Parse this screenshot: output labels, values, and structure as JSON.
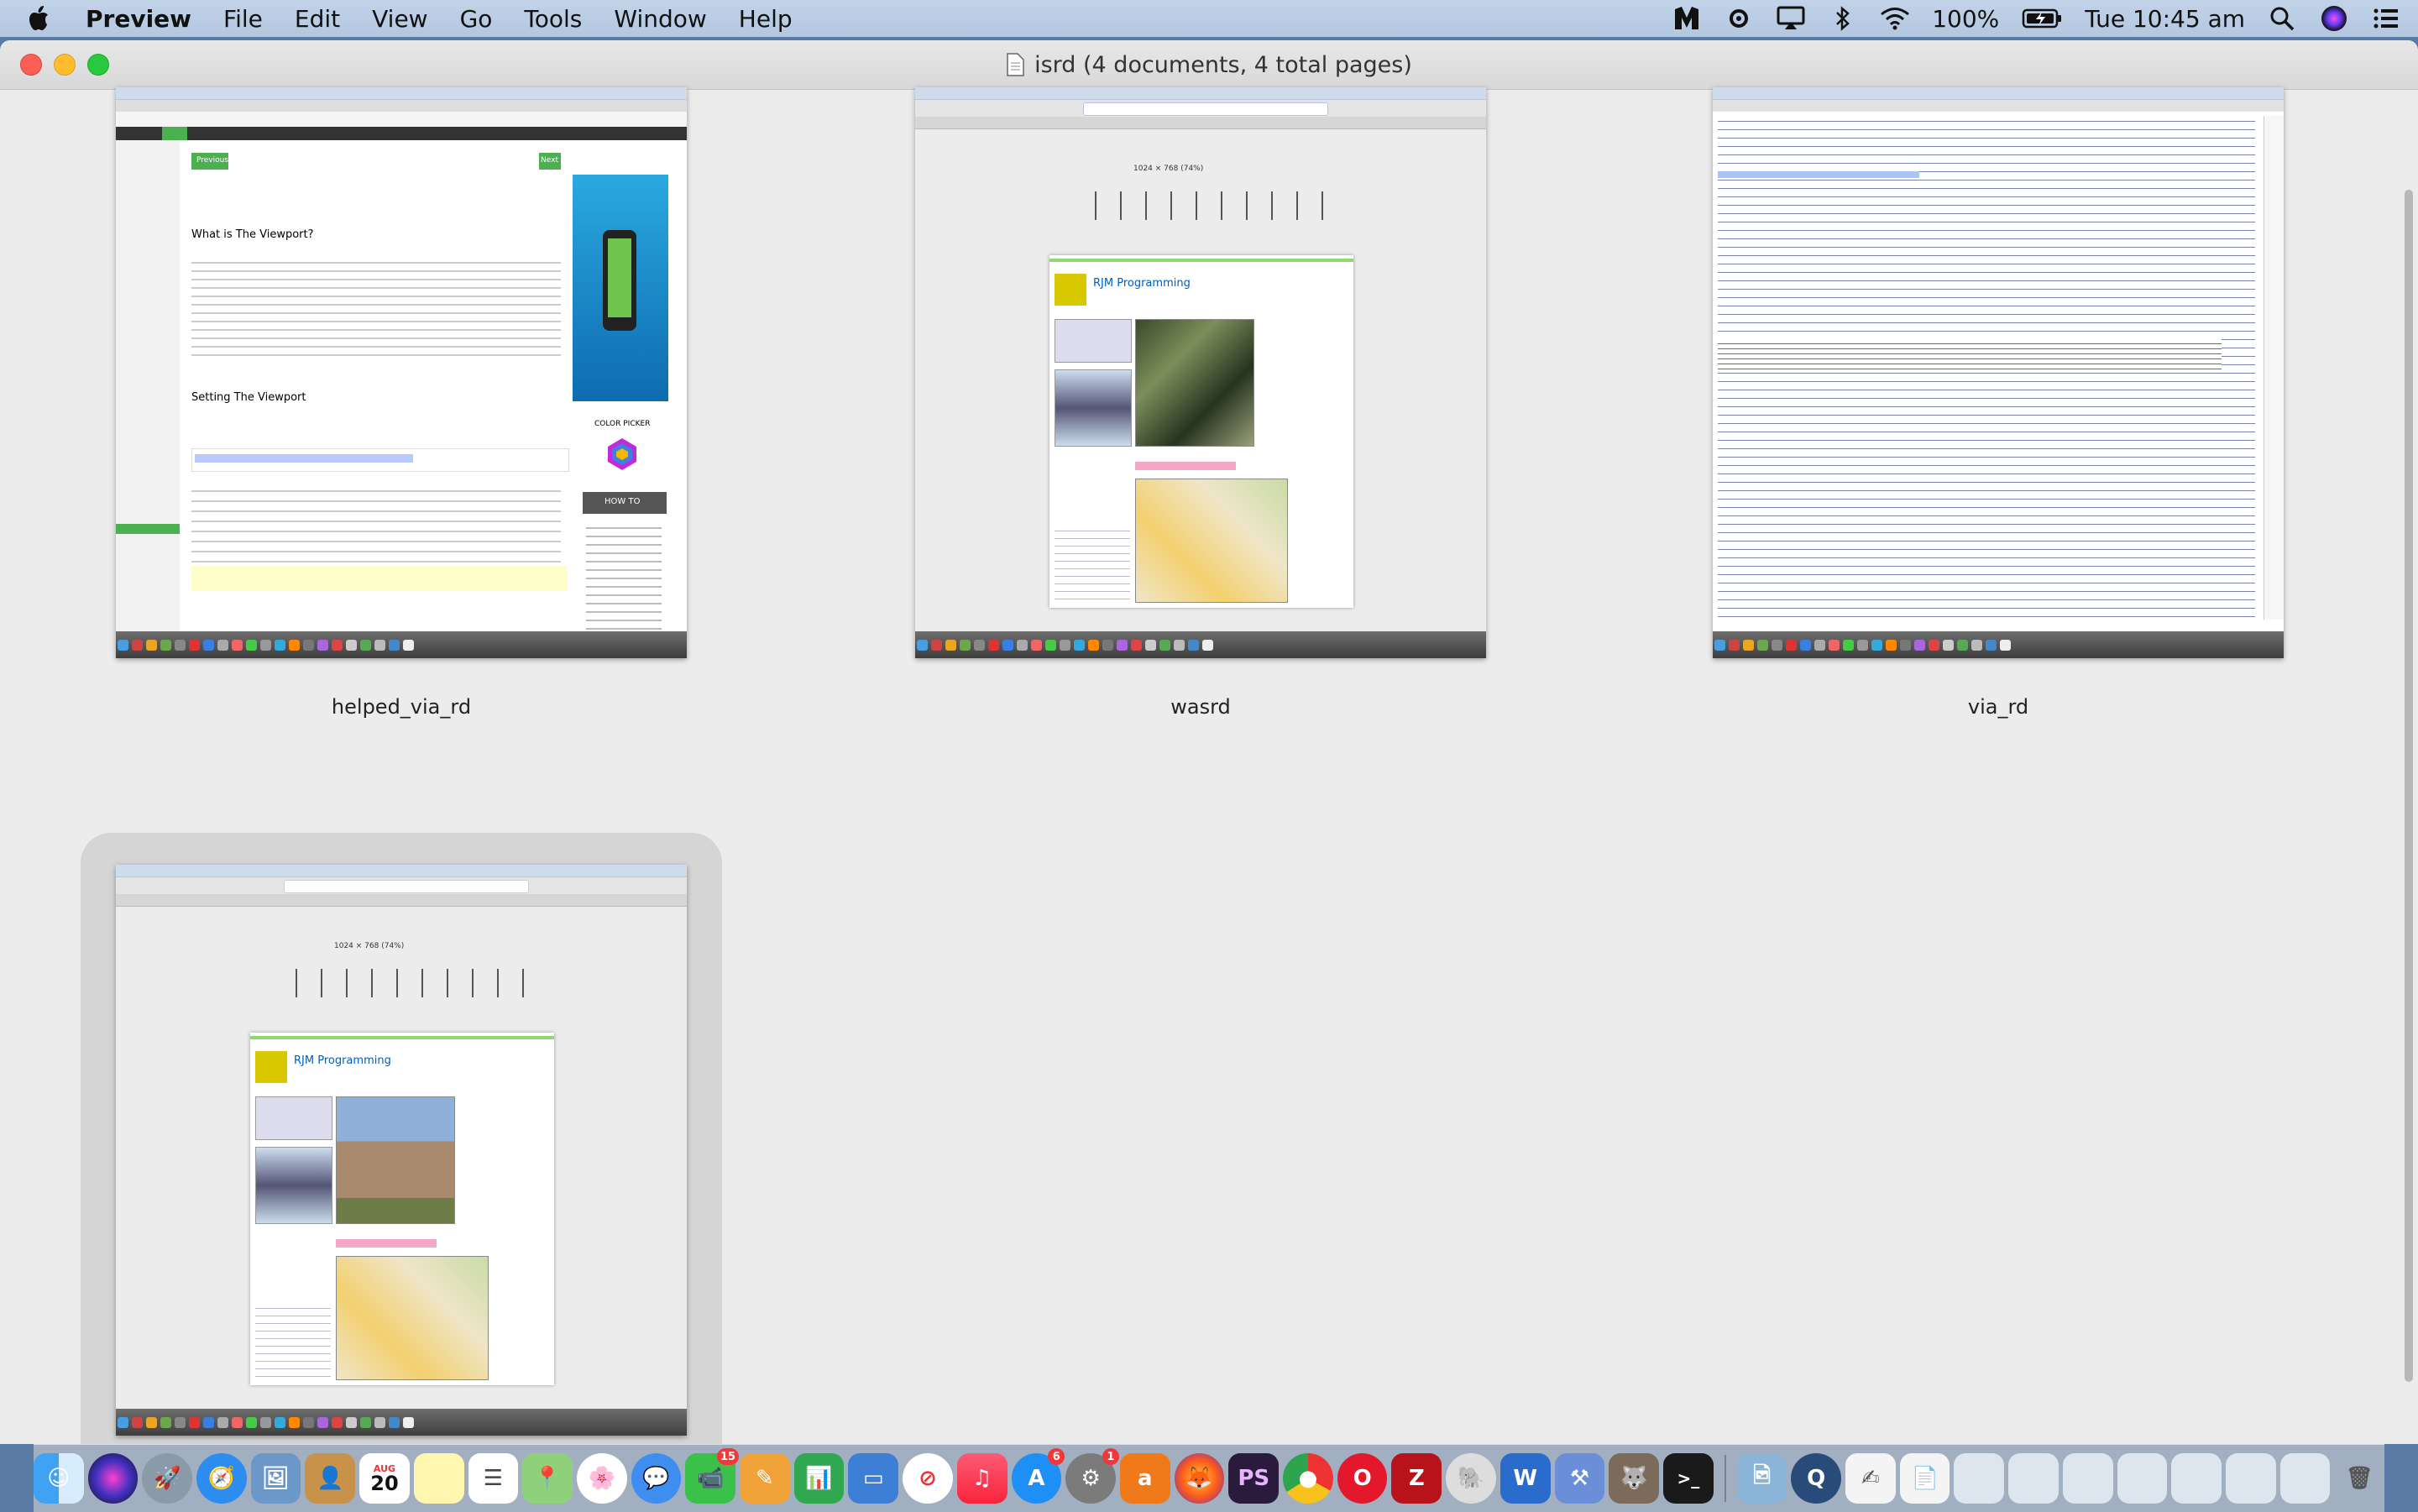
{
  "menubar": {
    "app_name": "Preview",
    "menus": [
      "File",
      "Edit",
      "View",
      "Go",
      "Tools",
      "Window",
      "Help"
    ],
    "battery": "100%",
    "clock": "Tue 10:45 am"
  },
  "window": {
    "title": "isrd (4 documents, 4 total pages)"
  },
  "thumbnails": [
    {
      "caption": "helped_via_rd",
      "selected": false
    },
    {
      "caption": "wasrd",
      "selected": false
    },
    {
      "caption": "via_rd",
      "selected": false
    },
    {
      "caption": "",
      "selected": true
    }
  ],
  "thumb_text": {
    "w3_heading1": "What is The Viewport?",
    "w3_heading2": "Setting The Viewport",
    "w3_next": "Next",
    "w3_prev": "Previous",
    "w3_color_picker": "COLOR PICKER",
    "w3_how_to": "HOW TO",
    "rjm_title": "RJM Programming",
    "device_size": "1024 × 768 (74%)"
  },
  "dock": {
    "calendar_month": "AUG",
    "calendar_day": "20",
    "badge_messages": "15",
    "badge_appstore": "6",
    "badge_prefs": "1"
  }
}
